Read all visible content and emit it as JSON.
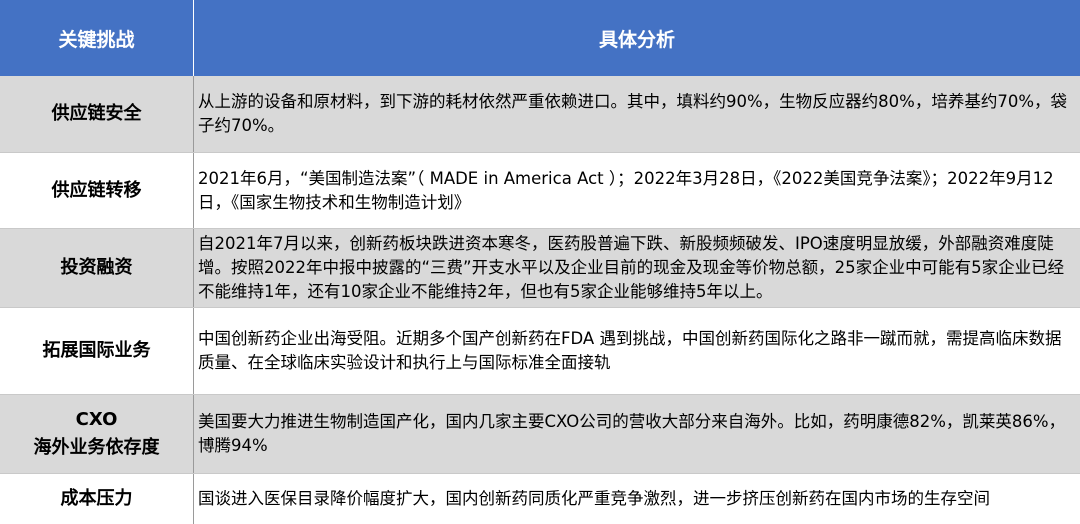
{
  "header": {
    "col1": "关键挑战",
    "col2": "具体分析"
  },
  "rows": [
    {
      "label": "供应链安全",
      "text": "从上游的设备和原材料，到下游的耗材依然严重依赖进口。其中，填料约90%，生物反应器约80%，培养基约70%，袋子约70%。"
    },
    {
      "label": "供应链转移",
      "text": "2021年6月，“美国制造法案”（ MADE in America Act ）；2022年3月28日，《2022美国竞争法案》；2022年9月12日，《国家生物技术和生物制造计划》"
    },
    {
      "label": "投资融资",
      "text": "自2021年7月以来，创新药板块跌进资本寒冬，医药股普遍下跌、新股频频破发、IPO速度明显放缓，外部融资难度陡增。按照2022年中报中披露的“三费”开支水平以及企业目前的现金及现金等价物总额，25家企业中可能有5家企业已经不能维持1年，还有10家企业不能维持2年，但也有5家企业能够维持5年以上。"
    },
    {
      "label": "拓展国际业务",
      "text": "中国创新药企业出海受阻。近期多个国产创新药在FDA 遇到挑战，中国创新药国际化之路非一蹴而就，需提高临床数据质量、在全球临床实验设计和执行上与国际标准全面接轨"
    },
    {
      "label_line1": "CXO",
      "label_line2": "海外业务依存度",
      "text": "美国要大力推进生物制造国产化，国内几家主要CXO公司的营收大部分来自海外。比如，药明康德82%，凯莱英86%，博腾94%"
    },
    {
      "label": "成本压力",
      "text": "国谈进入医保目录降价幅度扩大，国内创新药同质化严重竞争激烈，进一步挤压创新药在国内市场的生存空间"
    }
  ],
  "colors": {
    "header_bg": "#4472C4",
    "header_text": "#FFFFFF",
    "shaded_row_bg": "#D9D9D9"
  }
}
